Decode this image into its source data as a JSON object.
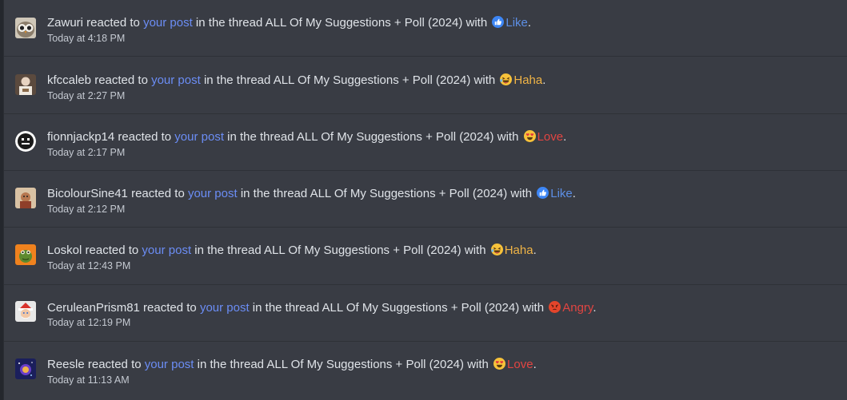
{
  "alerts": [
    {
      "username": "Zawuri",
      "action": " reacted to ",
      "post_link": "your post",
      "thread_prefix": " in the thread ",
      "thread_title": "ALL Of My Suggestions + Poll (2024)",
      "with_text": " with ",
      "reaction": "Like",
      "reaction_icon": "like-icon",
      "end": ".",
      "time": "Today at 4:18 PM"
    },
    {
      "username": "kfccaleb",
      "action": " reacted to ",
      "post_link": "your post",
      "thread_prefix": " in the thread ",
      "thread_title": "ALL Of My Suggestions + Poll (2024)",
      "with_text": " with ",
      "reaction": "Haha",
      "reaction_icon": "haha-icon",
      "end": ".",
      "time": "Today at 2:27 PM"
    },
    {
      "username": "fionnjackp14",
      "action": " reacted to ",
      "post_link": "your post",
      "thread_prefix": " in the thread ",
      "thread_title": "ALL Of My Suggestions + Poll (2024)",
      "with_text": " with ",
      "reaction": "Love",
      "reaction_icon": "love-icon",
      "end": ".",
      "time": "Today at 2:17 PM"
    },
    {
      "username": "BicolourSine41",
      "action": " reacted to ",
      "post_link": "your post",
      "thread_prefix": " in the thread ",
      "thread_title": "ALL Of My Suggestions + Poll (2024)",
      "with_text": " with ",
      "reaction": "Like",
      "reaction_icon": "like-icon",
      "end": ".",
      "time": "Today at 2:12 PM"
    },
    {
      "username": "Loskol",
      "action": " reacted to ",
      "post_link": "your post",
      "thread_prefix": " in the thread ",
      "thread_title": "ALL Of My Suggestions + Poll (2024)",
      "with_text": " with ",
      "reaction": "Haha",
      "reaction_icon": "haha-icon",
      "end": ".",
      "time": "Today at 12:43 PM"
    },
    {
      "username": "CeruleanPrism81",
      "action": " reacted to ",
      "post_link": "your post",
      "thread_prefix": " in the thread ",
      "thread_title": "ALL Of My Suggestions + Poll (2024)",
      "with_text": " with ",
      "reaction": "Angry",
      "reaction_icon": "angry-icon",
      "end": ".",
      "time": "Today at 12:19 PM"
    },
    {
      "username": "Reesle",
      "action": " reacted to ",
      "post_link": "your post",
      "thread_prefix": " in the thread ",
      "thread_title": "ALL Of My Suggestions + Poll (2024)",
      "with_text": " with ",
      "reaction": "Love",
      "reaction_icon": "love-icon",
      "end": ".",
      "time": "Today at 11:13 AM"
    }
  ],
  "colors": {
    "background": "#393c44",
    "link": "#6b8df5",
    "like": "#5d8fe6",
    "haha": "#f0b446",
    "love": "#e24542",
    "angry": "#e24542",
    "text": "#dfe3e8",
    "time": "#c4c9d1"
  }
}
